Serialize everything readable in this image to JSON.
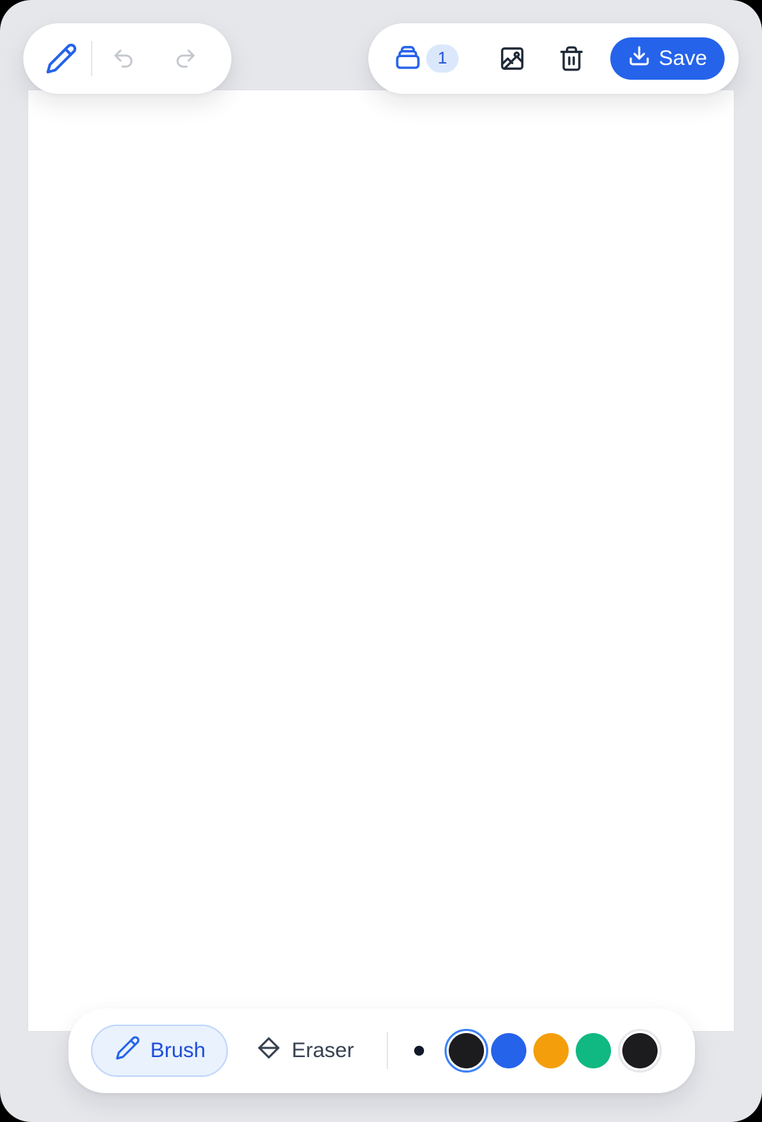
{
  "toolbar_top_left": {
    "brush_icon": "pencil-icon",
    "undo_icon": "undo-icon",
    "redo_icon": "redo-icon"
  },
  "toolbar_top_right": {
    "layers_icon": "layers-icon",
    "layer_count": "1",
    "image_icon": "image-icon",
    "delete_icon": "trash-icon",
    "save_label": "Save",
    "save_icon": "download-icon"
  },
  "toolbar_bottom": {
    "brush_label": "Brush",
    "eraser_label": "Eraser",
    "active_tool": "Brush",
    "palette": [
      {
        "name": "black",
        "color": "#1c1c1e",
        "selected": true
      },
      {
        "name": "blue",
        "color": "#2563eb",
        "selected": false
      },
      {
        "name": "orange",
        "color": "#f59e0b",
        "selected": false
      },
      {
        "name": "green",
        "color": "#10b981",
        "selected": false
      },
      {
        "name": "custom",
        "color": "#1c1c1e",
        "selected": false
      }
    ]
  },
  "colors": {
    "accent": "#2563eb",
    "background": "#e5e7eb",
    "canvas": "#ffffff"
  }
}
